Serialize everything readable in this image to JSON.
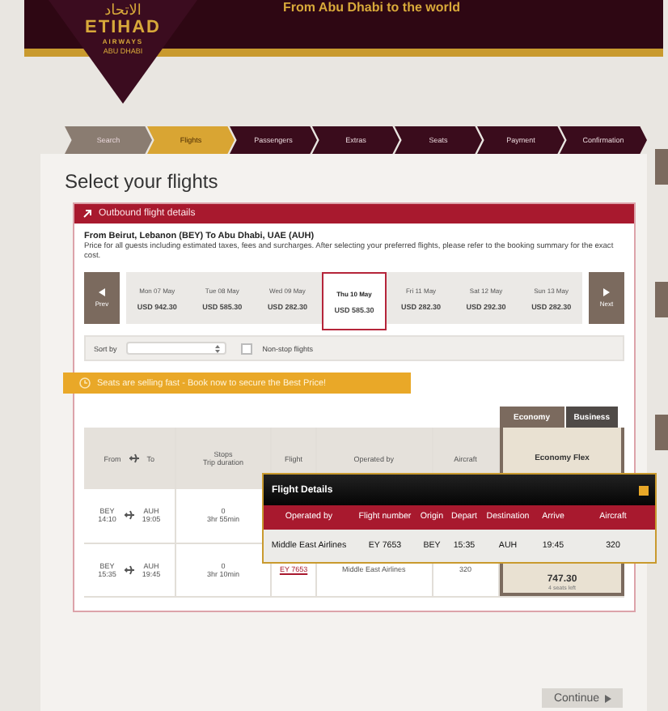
{
  "header": {
    "tagline": "From Abu Dhabi to the world",
    "logo": {
      "arabic": "الاتحاد",
      "name": "ETIHAD",
      "sub": "AIRWAYS",
      "city": "ABU DHABI"
    }
  },
  "steps": [
    {
      "label": "Search",
      "completed": true,
      "selected": false
    },
    {
      "label": "Flights",
      "completed": false,
      "selected": true
    },
    {
      "label": "Passengers",
      "completed": false,
      "selected": false
    },
    {
      "label": "Extras",
      "completed": false,
      "selected": false
    },
    {
      "label": "Seats",
      "completed": false,
      "selected": false
    },
    {
      "label": "Payment",
      "completed": false,
      "selected": false
    },
    {
      "label": "Confirmation",
      "completed": false,
      "selected": false
    }
  ],
  "title": "Select your flights",
  "panel": {
    "title": "Outbound flight details",
    "route": "From Beirut, Lebanon (BEY) To Abu Dhabi, UAE (AUH)",
    "note": "Price for all guests including estimated taxes, fees and surcharges. After selecting your preferred flights, please refer to the booking summary for the exact cost.",
    "prev": "Prev",
    "next": "Next",
    "dates": [
      {
        "day": "Mon 07 May",
        "price": "USD 942.30",
        "selected": false
      },
      {
        "day": "Tue 08 May",
        "price": "USD 585.30",
        "selected": false
      },
      {
        "day": "Wed 09 May",
        "price": "USD 282.30",
        "selected": false
      },
      {
        "day": "Thu 10 May",
        "price": "USD 585.30",
        "selected": true
      },
      {
        "day": "Fri 11 May",
        "price": "USD 282.30",
        "selected": false
      },
      {
        "day": "Sat 12 May",
        "price": "USD 292.30",
        "selected": false
      },
      {
        "day": "Sun 13 May",
        "price": "USD 282.30",
        "selected": false
      }
    ],
    "sort_label": "Sort by",
    "nonstop": {
      "label": "Non-stop flights",
      "checked": false
    },
    "banner": "Seats are selling fast - Book now to secure the Best Price!",
    "cabins": [
      {
        "label": "Economy",
        "selected": true
      },
      {
        "label": "Business",
        "selected": false
      }
    ],
    "columns": {
      "from": "From",
      "to": "To",
      "stops": "Stops",
      "duration": "Trip duration",
      "flight": "Flight",
      "operated": "Operated by",
      "aircraft": "Aircraft",
      "fare": "Economy Flex"
    },
    "rows": [
      {
        "from": "BEY",
        "dep": "14:10",
        "to": "AUH",
        "arr": "19:05",
        "stops": "0",
        "duration": "3hr 55min"
      },
      {
        "from": "BEY",
        "dep": "15:35",
        "to": "AUH",
        "arr": "19:45",
        "stops": "0",
        "duration": "3hr 10min",
        "flight": "EY 7653",
        "operated": "Middle East Airlines",
        "aircraft": "320",
        "price": "747.30",
        "seats": "4 seats left"
      }
    ]
  },
  "popup": {
    "title": "Flight Details",
    "columns": [
      "Operated by",
      "Flight number",
      "Origin",
      "Depart",
      "Destination",
      "Arrive",
      "Aircraft"
    ],
    "row": [
      "Middle East Airlines",
      "EY 7653",
      "BEY",
      "15:35",
      "AUH",
      "19:45",
      "320"
    ]
  },
  "continue": "Continue"
}
